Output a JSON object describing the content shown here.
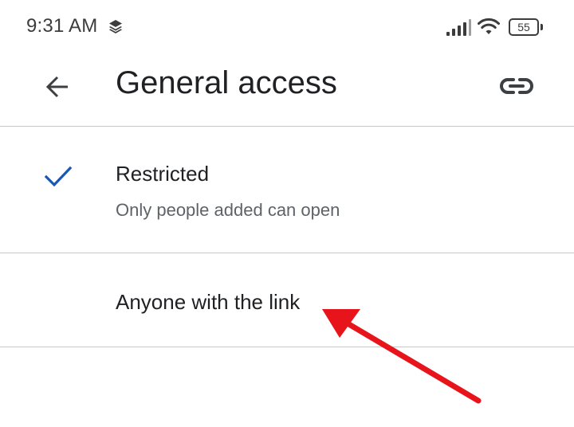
{
  "status_bar": {
    "time": "9:31 AM",
    "battery_level": "55",
    "icons": [
      "layers-icon",
      "signal-icon",
      "wifi-icon",
      "battery-icon"
    ]
  },
  "app_bar": {
    "title": "General access",
    "back_icon": "arrow-back-icon",
    "link_icon": "link-icon"
  },
  "options": [
    {
      "label": "Restricted",
      "sublabel": "Only people added can open",
      "selected": true
    },
    {
      "label": "Anyone with the link",
      "sublabel": "",
      "selected": false
    }
  ],
  "colors": {
    "check_mark": "#1a56b8",
    "annotation_arrow": "#e8141b",
    "divider": "#c7c7c7",
    "text_primary": "#202124",
    "text_secondary": "#5f6368"
  }
}
